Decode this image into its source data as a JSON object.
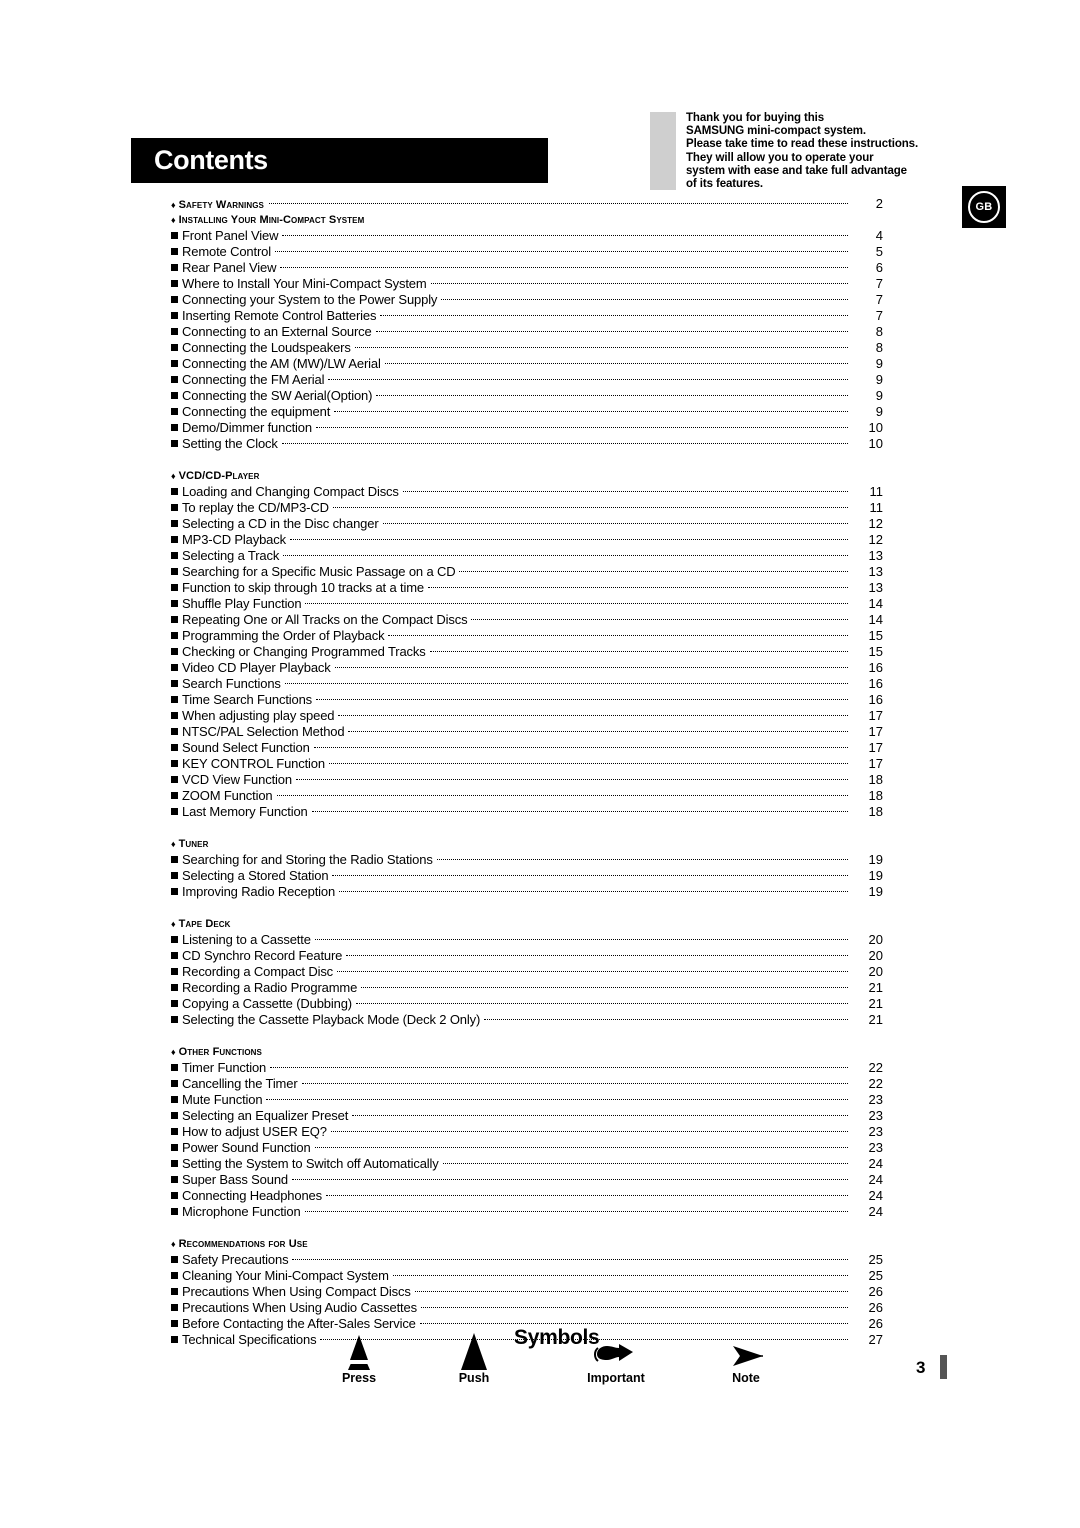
{
  "intro": {
    "text": "Thank you for buying this\nSAMSUNG mini-compact system.\nPlease take time to read these instructions.\nThey will allow you to operate your\nsystem with ease and take full advantage\nof its features."
  },
  "badge": {
    "label": "GB"
  },
  "banner": {
    "title": "Contents"
  },
  "page_number": "3",
  "toc": {
    "rows": [
      {
        "type": "section",
        "label": "Safety Warnings",
        "page": "2"
      },
      {
        "type": "section",
        "label": "Installing Your Mini-Compact System",
        "page": ""
      },
      {
        "type": "item",
        "label": "Front Panel View",
        "page": "4"
      },
      {
        "type": "item",
        "label": "Remote Control",
        "page": "5"
      },
      {
        "type": "item",
        "label": "Rear Panel View",
        "page": "6"
      },
      {
        "type": "item",
        "label": "Where to Install Your Mini-Compact System",
        "page": "7"
      },
      {
        "type": "item",
        "label": "Connecting your System to the Power Supply",
        "page": "7"
      },
      {
        "type": "item",
        "label": "Inserting Remote Control Batteries",
        "page": "7"
      },
      {
        "type": "item",
        "label": "Connecting to an External Source",
        "page": "8"
      },
      {
        "type": "item",
        "label": "Connecting the Loudspeakers",
        "page": "8"
      },
      {
        "type": "item",
        "label": "Connecting the AM (MW)/LW Aerial",
        "page": "9"
      },
      {
        "type": "item",
        "label": "Connecting the FM Aerial",
        "page": "9"
      },
      {
        "type": "item",
        "label": "Connecting the SW Aerial(Option)",
        "page": "9"
      },
      {
        "type": "item",
        "label": "Connecting the equipment",
        "page": "9"
      },
      {
        "type": "item",
        "label": "Demo/Dimmer function",
        "page": "10"
      },
      {
        "type": "item",
        "label": "Setting the Clock",
        "page": "10"
      },
      {
        "type": "spacer"
      },
      {
        "type": "section",
        "label": "VCD/CD-Player",
        "page": ""
      },
      {
        "type": "item",
        "label": "Loading and Changing Compact Discs",
        "page": "11"
      },
      {
        "type": "item",
        "label": "To replay the CD/MP3-CD",
        "page": "11"
      },
      {
        "type": "item",
        "label": "Selecting a CD in the Disc changer",
        "page": "12"
      },
      {
        "type": "item",
        "label": "MP3-CD Playback",
        "page": "12"
      },
      {
        "type": "item",
        "label": "Selecting a Track",
        "page": "13"
      },
      {
        "type": "item",
        "label": "Searching for a Specific Music Passage on a CD",
        "page": "13"
      },
      {
        "type": "item",
        "label": "Function to skip through 10 tracks at a time",
        "page": "13"
      },
      {
        "type": "item",
        "label": "Shuffle Play Function",
        "page": "14"
      },
      {
        "type": "item",
        "label": "Repeating One or All Tracks on the Compact Discs",
        "page": "14"
      },
      {
        "type": "item",
        "label": "Programming the Order of Playback",
        "page": "15"
      },
      {
        "type": "item",
        "label": "Checking or Changing Programmed Tracks",
        "page": "15"
      },
      {
        "type": "item",
        "label": "Video CD Player Playback",
        "page": "16"
      },
      {
        "type": "item",
        "label": "Search Functions",
        "page": "16"
      },
      {
        "type": "item",
        "label": "Time Search Functions",
        "page": "16"
      },
      {
        "type": "item",
        "label": "When adjusting play speed",
        "page": "17"
      },
      {
        "type": "item",
        "label": "NTSC/PAL Selection Method",
        "page": "17"
      },
      {
        "type": "item",
        "label": "Sound Select Function",
        "page": "17"
      },
      {
        "type": "item",
        "label": "KEY CONTROL Function",
        "page": "17"
      },
      {
        "type": "item",
        "label": "VCD View Function",
        "page": "18"
      },
      {
        "type": "item",
        "label": "ZOOM Function",
        "page": "18"
      },
      {
        "type": "item",
        "label": "Last Memory Function",
        "page": "18"
      },
      {
        "type": "spacer"
      },
      {
        "type": "section",
        "label": "Tuner",
        "page": ""
      },
      {
        "type": "item",
        "label": "Searching for and Storing the Radio Stations",
        "page": "19"
      },
      {
        "type": "item",
        "label": "Selecting a Stored Station",
        "page": "19"
      },
      {
        "type": "item",
        "label": "Improving Radio Reception",
        "page": "19"
      },
      {
        "type": "spacer"
      },
      {
        "type": "section",
        "label": "Tape Deck",
        "page": ""
      },
      {
        "type": "item",
        "label": "Listening to a Cassette",
        "page": "20"
      },
      {
        "type": "item",
        "label": "CD Synchro Record Feature",
        "page": "20"
      },
      {
        "type": "item",
        "label": "Recording a Compact Disc",
        "page": "20"
      },
      {
        "type": "item",
        "label": "Recording a Radio Programme",
        "page": "21"
      },
      {
        "type": "item",
        "label": "Copying a Cassette (Dubbing)",
        "page": "21"
      },
      {
        "type": "item",
        "label": "Selecting the Cassette Playback Mode (Deck 2 Only)",
        "page": "21"
      },
      {
        "type": "spacer"
      },
      {
        "type": "section",
        "label": "Other Functions",
        "page": ""
      },
      {
        "type": "item",
        "label": "Timer Function",
        "page": "22"
      },
      {
        "type": "item",
        "label": "Cancelling the Timer",
        "page": "22"
      },
      {
        "type": "item",
        "label": "Mute Function",
        "page": "23"
      },
      {
        "type": "item",
        "label": "Selecting an Equalizer Preset",
        "page": "23"
      },
      {
        "type": "item",
        "label": "How to adjust USER EQ?",
        "page": "23"
      },
      {
        "type": "item",
        "label": "Power Sound Function",
        "page": "23"
      },
      {
        "type": "item",
        "label": "Setting the System to Switch off Automatically",
        "page": "24"
      },
      {
        "type": "item",
        "label": "Super Bass Sound",
        "page": "24"
      },
      {
        "type": "item",
        "label": "Connecting Headphones",
        "page": "24"
      },
      {
        "type": "item",
        "label": "Microphone Function",
        "page": "24"
      },
      {
        "type": "spacer"
      },
      {
        "type": "section",
        "label": "Recommendations for Use",
        "page": ""
      },
      {
        "type": "item",
        "label": "Safety Precautions",
        "page": "25"
      },
      {
        "type": "item",
        "label": "Cleaning Your Mini-Compact System",
        "page": "25"
      },
      {
        "type": "item",
        "label": "Precautions When Using Compact Discs",
        "page": "26"
      },
      {
        "type": "item",
        "label": "Precautions When Using Audio Cassettes",
        "page": "26"
      },
      {
        "type": "item",
        "label": "Before Contacting the After-Sales Service",
        "page": "26"
      },
      {
        "type": "item",
        "label": "Technical Specifications",
        "page": "27"
      }
    ]
  },
  "symbols": {
    "title": "Symbols",
    "items": [
      {
        "icon": "press-triangle-icon",
        "label": "Press"
      },
      {
        "icon": "push-triangle-icon",
        "label": "Push"
      },
      {
        "icon": "pointing-hand-icon",
        "label": "Important"
      },
      {
        "icon": "arrow-note-icon",
        "label": "Note"
      }
    ]
  },
  "colors": {
    "banner_bg": "#000000",
    "gray_block": "#cfcfcf",
    "text": "#000000",
    "page_tab": "#555555"
  }
}
